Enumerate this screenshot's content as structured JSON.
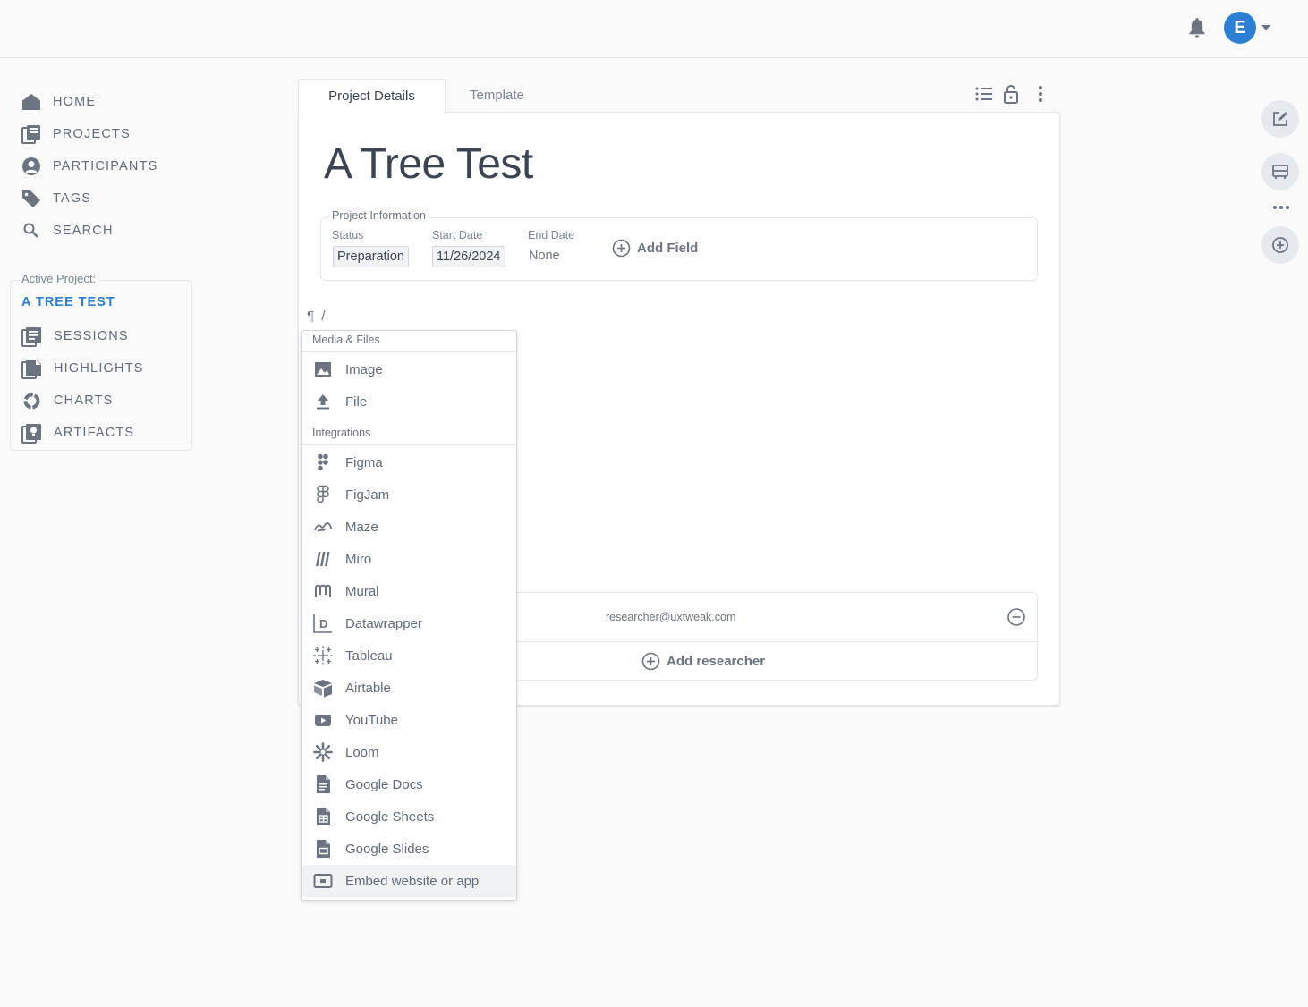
{
  "header": {
    "avatar_initial": "E"
  },
  "nav": {
    "items": [
      {
        "label": "HOME",
        "icon": "home-icon"
      },
      {
        "label": "PROJECTS",
        "icon": "projects-icon"
      },
      {
        "label": "PARTICIPANTS",
        "icon": "participants-icon"
      },
      {
        "label": "TAGS",
        "icon": "tags-icon"
      },
      {
        "label": "SEARCH",
        "icon": "search-icon"
      }
    ]
  },
  "active_project": {
    "label": "Active Project:",
    "name": "A TREE TEST",
    "items": [
      {
        "label": "SESSIONS",
        "icon": "sessions-icon"
      },
      {
        "label": "HIGHLIGHTS",
        "icon": "highlights-icon"
      },
      {
        "label": "CHARTS",
        "icon": "charts-icon"
      },
      {
        "label": "ARTIFACTS",
        "icon": "artifacts-icon"
      }
    ]
  },
  "tabs": {
    "details": "Project Details",
    "template": "Template"
  },
  "project": {
    "title": "A Tree Test",
    "info_label": "Project Information",
    "status_label": "Status",
    "status_value": "Preparation",
    "start_label": "Start Date",
    "start_value": "11/26/2024",
    "end_label": "End Date",
    "end_value": "None",
    "add_field": "Add Field"
  },
  "editor": {
    "pilcrow": "¶",
    "slash": "/"
  },
  "researchers": {
    "email": "researcher@uxtweak.com",
    "add_label": "Add researcher"
  },
  "menu": {
    "section_media": "Media & Files",
    "section_integrations": "Integrations",
    "media_items": [
      {
        "label": "Image",
        "icon": "image-icon"
      },
      {
        "label": "File",
        "icon": "upload-icon"
      }
    ],
    "integration_items": [
      {
        "label": "Figma",
        "icon": "figma-icon"
      },
      {
        "label": "FigJam",
        "icon": "figjam-icon"
      },
      {
        "label": "Maze",
        "icon": "maze-icon"
      },
      {
        "label": "Miro",
        "icon": "miro-icon"
      },
      {
        "label": "Mural",
        "icon": "mural-icon"
      },
      {
        "label": "Datawrapper",
        "icon": "datawrapper-icon"
      },
      {
        "label": "Tableau",
        "icon": "tableau-icon"
      },
      {
        "label": "Airtable",
        "icon": "airtable-icon"
      },
      {
        "label": "YouTube",
        "icon": "youtube-icon"
      },
      {
        "label": "Loom",
        "icon": "loom-icon"
      },
      {
        "label": "Google Docs",
        "icon": "google-docs-icon"
      },
      {
        "label": "Google Sheets",
        "icon": "google-sheets-icon"
      },
      {
        "label": "Google Slides",
        "icon": "google-slides-icon"
      },
      {
        "label": "Embed website or app",
        "icon": "embed-icon"
      }
    ]
  },
  "colors": {
    "accent": "#2d7fd3",
    "icon": "#6b7480",
    "text": "#5f6b7a"
  }
}
